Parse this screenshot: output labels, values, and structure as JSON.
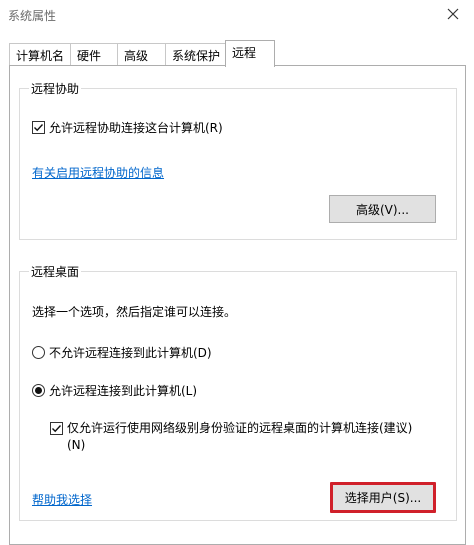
{
  "window": {
    "title": "系统属性"
  },
  "tabs": [
    {
      "label": "计算机名"
    },
    {
      "label": "硬件"
    },
    {
      "label": "高级"
    },
    {
      "label": "系统保护"
    },
    {
      "label": "远程",
      "active": true
    }
  ],
  "remote_assistance": {
    "group_label": "远程协助",
    "allow_checkbox_label": "允许远程协助连接这台计算机(R)",
    "allow_checked": true,
    "info_link": "有关启用远程协助的信息",
    "advanced_button": "高级(V)..."
  },
  "remote_desktop": {
    "group_label": "远程桌面",
    "instruction": "选择一个选项，然后指定谁可以连接。",
    "option_disallow": "不允许远程连接到此计算机(D)",
    "option_allow": "允许远程连接到此计算机(L)",
    "selected_option": "allow",
    "nla_checkbox_line1": "仅允许运行使用网络级别身份验证的远程桌面的计算机连接(建议)",
    "nla_checkbox_line2": "(N)",
    "nla_checked": true,
    "help_link": "帮助我选择",
    "select_users_button": "选择用户(S)..."
  },
  "icons": {
    "close": "close-icon",
    "check": "checkmark-icon"
  },
  "colors": {
    "link": "#0066cc",
    "highlight": "#d0202a",
    "button_face": "#e1e1e1"
  }
}
